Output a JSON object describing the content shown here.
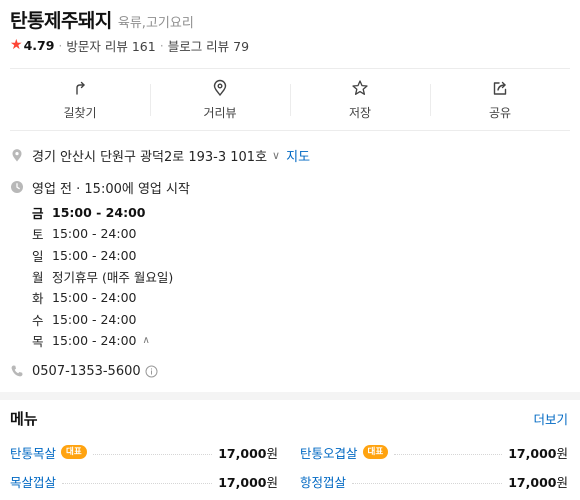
{
  "place": {
    "name": "탄통제주돼지",
    "category": "육류,고기요리",
    "rating": "4.79",
    "visitor_reviews": "방문자 리뷰 161",
    "blog_reviews": "블로그 리뷰 79"
  },
  "actions": [
    {
      "label": "길찾기",
      "icon": "directions-icon"
    },
    {
      "label": "거리뷰",
      "icon": "location-pin-icon"
    },
    {
      "label": "저장",
      "icon": "star-icon"
    },
    {
      "label": "공유",
      "icon": "share-icon"
    }
  ],
  "address": {
    "text": "경기 안산시 단원구 광덕2로 193-3 101호",
    "map_link": "지도"
  },
  "business": {
    "status": "영업 전 · 15:00에 영업 시작",
    "hours": [
      {
        "day": "금",
        "time": "15:00 - 24:00"
      },
      {
        "day": "토",
        "time": "15:00 - 24:00"
      },
      {
        "day": "일",
        "time": "15:00 - 24:00"
      },
      {
        "day": "월",
        "time": "정기휴무 (매주 월요일)"
      },
      {
        "day": "화",
        "time": "15:00 - 24:00"
      },
      {
        "day": "수",
        "time": "15:00 - 24:00"
      },
      {
        "day": "목",
        "time": "15:00 - 24:00"
      }
    ]
  },
  "phone": "0507-1353-5600",
  "menu": {
    "title": "메뉴",
    "more": "더보기",
    "items": [
      {
        "name": "탄통목살",
        "badge": "대표",
        "price": "17,000",
        "unit": "원"
      },
      {
        "name": "탄통오겹살",
        "badge": "대표",
        "price": "17,000",
        "unit": "원"
      },
      {
        "name": "목살껍살",
        "price": "17,000",
        "unit": "원"
      },
      {
        "name": "항정껍살",
        "price": "17,000",
        "unit": "원"
      }
    ]
  },
  "colors": {
    "accent_link": "#0068c3",
    "rating_star": "#fd4535",
    "badge": "#ffa310"
  }
}
